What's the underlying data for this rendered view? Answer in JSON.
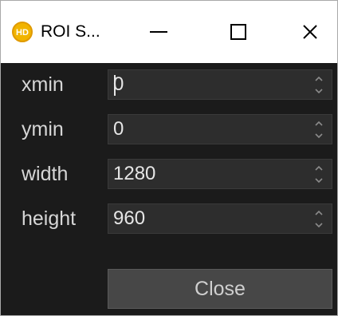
{
  "window": {
    "title": "ROI S...",
    "icon": "hd-logo-icon",
    "controls": [
      "minimize-icon",
      "maximize-icon",
      "close-icon"
    ]
  },
  "fields": [
    {
      "label": "xmin",
      "value": "0"
    },
    {
      "label": "ymin",
      "value": "0"
    },
    {
      "label": "width",
      "value": "1280"
    },
    {
      "label": "height",
      "value": "960"
    }
  ],
  "close_label": "Close",
  "colors": {
    "background": "#1b1b1b",
    "field_bg": "#2d2d2d",
    "button_bg": "#474747",
    "icon_yellow": "#f1b400"
  }
}
